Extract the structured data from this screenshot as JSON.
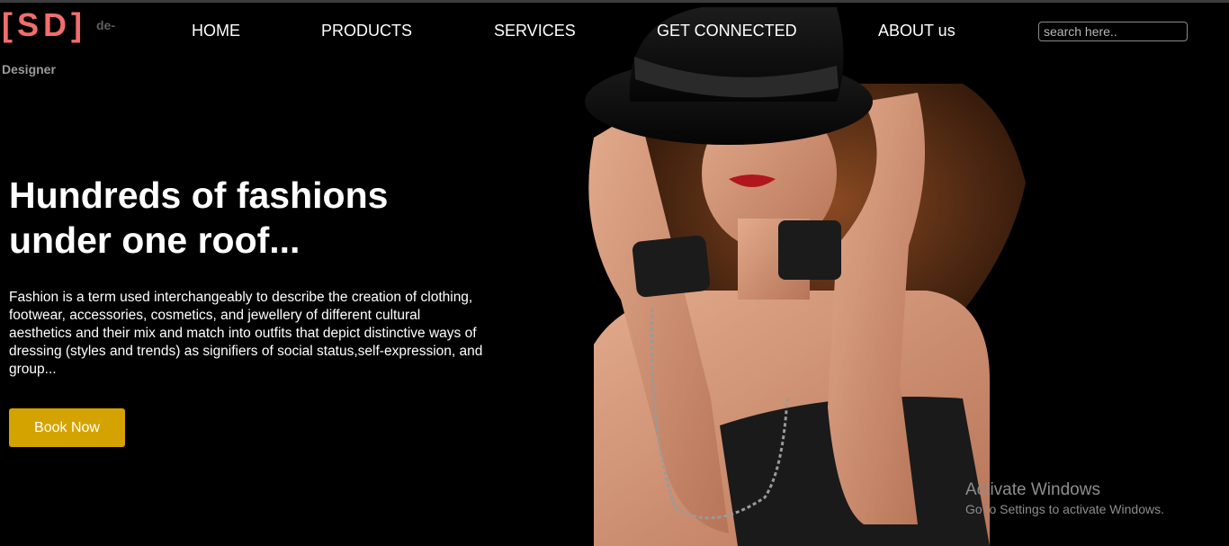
{
  "logo": {
    "mark": "[SD]",
    "suffix_line1": "de-",
    "suffix_line2": "Designer"
  },
  "nav": {
    "items": [
      {
        "label": "HOME"
      },
      {
        "label": "PRODUCTS"
      },
      {
        "label": "SERVICES"
      },
      {
        "label": "GET CONNECTED"
      },
      {
        "label": "ABOUT us"
      }
    ]
  },
  "search": {
    "placeholder": "search here.."
  },
  "hero": {
    "headline_line1": "Hundreds of fashions",
    "headline_line2": "under one roof...",
    "description": "Fashion is a term used interchangeably to describe the creation of clothing, footwear, accessories, cosmetics, and jewellery of different cultural aesthetics and their mix and match into outfits that depict distinctive ways of dressing (styles and trends) as signifiers of social status,self-expression, and group...",
    "button_label": "Book Now"
  },
  "watermark": {
    "title": "Activate Windows",
    "subtitle": "Go to Settings to activate Windows."
  },
  "colors": {
    "background": "#000000",
    "logo_accent": "#f26d6d",
    "button": "#d4a300",
    "text": "#ffffff"
  }
}
